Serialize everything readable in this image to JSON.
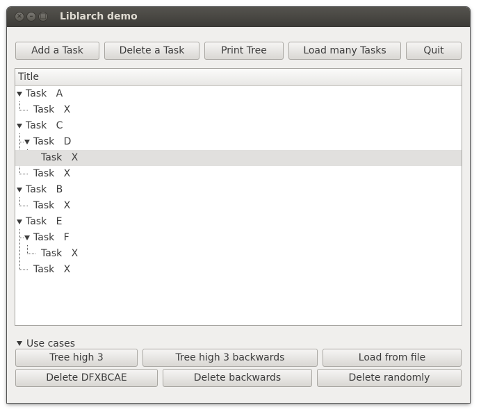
{
  "window": {
    "title": "Liblarch demo",
    "controls": {
      "close": "×",
      "minimize": "–",
      "maximize": "□"
    }
  },
  "toolbar": {
    "add_task": "Add a Task",
    "delete_task": "Delete a Task",
    "print_tree": "Print Tree",
    "load_many": "Load many Tasks",
    "quit": "Quit"
  },
  "tree": {
    "column_title": "Title",
    "rows": [
      {
        "label": "Task   A"
      },
      {
        "label": "Task   X"
      },
      {
        "label": "Task   C"
      },
      {
        "label": "Task   D"
      },
      {
        "label": "Task   X"
      },
      {
        "label": "Task   X"
      },
      {
        "label": "Task   B"
      },
      {
        "label": "Task   X"
      },
      {
        "label": "Task   E"
      },
      {
        "label": "Task   F"
      },
      {
        "label": "Task   X"
      },
      {
        "label": "Task   X"
      }
    ]
  },
  "use_cases": {
    "label": "Use cases",
    "tree_high_3": "Tree high 3",
    "tree_high_3_backwards": "Tree high 3 backwards",
    "load_from_file": "Load from file",
    "delete_dfxbcae": "Delete DFXBCAE",
    "delete_backwards": "Delete backwards",
    "delete_randomly": "Delete randomly"
  }
}
